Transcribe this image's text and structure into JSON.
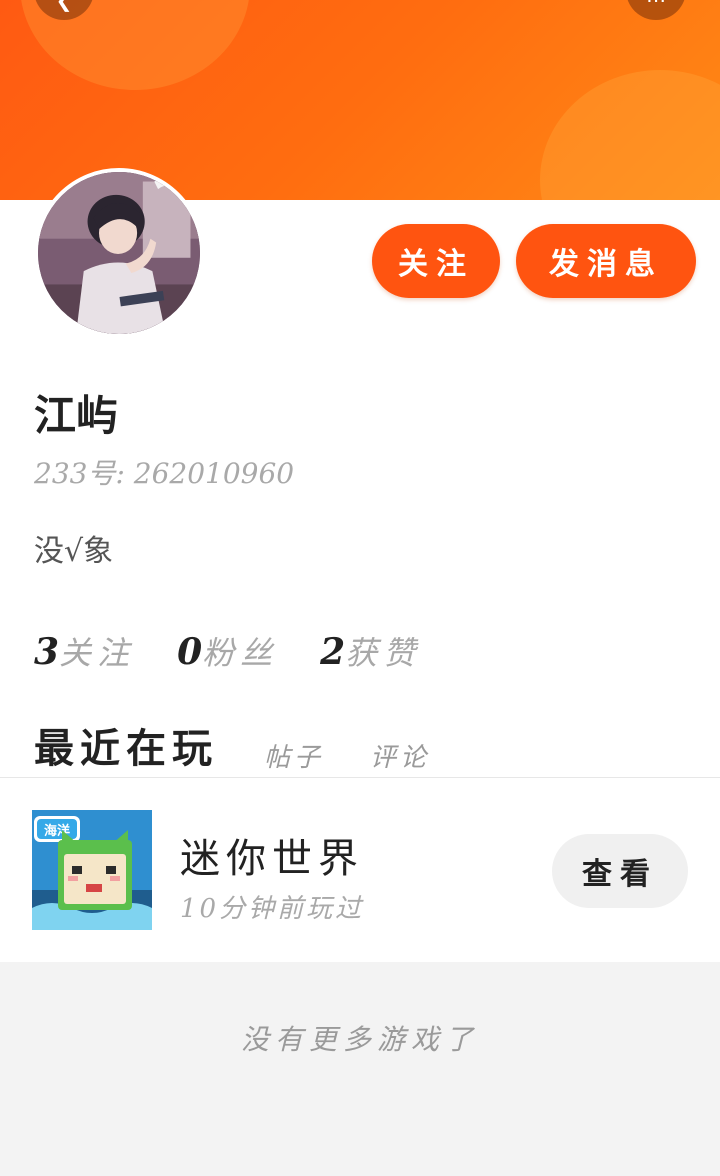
{
  "header": {
    "back_icon": "back-arrow-icon",
    "more_icon": "more-icon",
    "gradient_colors": [
      "#ff5a12",
      "#ff8a16"
    ]
  },
  "profile": {
    "name": "江屿",
    "uid_text": "233号: 262010960",
    "bio": "没√象",
    "buttons": {
      "follow": "关注",
      "message": "发消息"
    },
    "stats": [
      {
        "num": "3",
        "label": "关注"
      },
      {
        "num": "0",
        "label": "粉丝"
      },
      {
        "num": "2",
        "label": "获赞"
      }
    ],
    "accent_color": "#ff5410"
  },
  "tabs": [
    {
      "label": "最近在玩",
      "active": true
    },
    {
      "label": "帖子",
      "active": false
    },
    {
      "label": "评论",
      "active": false
    }
  ],
  "games": [
    {
      "icon_badge": "海洋",
      "title": "迷你世界",
      "last_played": "10分钟前玩过",
      "action": "查看"
    }
  ],
  "footer": {
    "no_more": "没有更多游戏了"
  }
}
